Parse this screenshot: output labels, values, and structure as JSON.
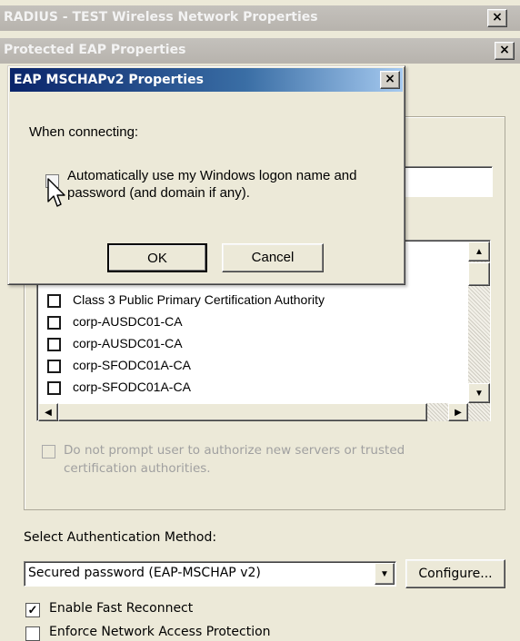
{
  "windows": {
    "outer_title": "RADIUS - TEST Wireless Network Properties",
    "peap_title": "Protected EAP Properties",
    "mschap_title": "EAP MSCHAPv2 Properties",
    "close_glyph": "×"
  },
  "mschap": {
    "when_connecting": "When connecting:",
    "auto_logon_line1": "Automatically use my Windows logon name and",
    "auto_logon_line2": "password (and domain if any).",
    "ok_label": "OK",
    "cancel_label": "Cancel"
  },
  "trusted_ca": {
    "items": [
      "Class 3 Public Primary Certification Authority",
      "corp-AUSDC01-CA",
      "corp-AUSDC01-CA",
      "corp-SFODC01A-CA",
      "corp-SFODC01A-CA"
    ],
    "do_not_prompt_line1": "Do not prompt user to authorize new servers or trusted",
    "do_not_prompt_line2": "certification authorities."
  },
  "auth": {
    "select_label": "Select Authentication Method:",
    "method_value": "Secured password (EAP-MSCHAP v2)",
    "configure_label": "Configure...",
    "fast_reconnect_label": "Enable Fast Reconnect",
    "fast_reconnect_checked": true,
    "nap_label": "Enforce Network Access Protection",
    "nap_checked": false
  },
  "icons": {
    "check": "✓",
    "arrow_up": "▲",
    "arrow_down": "▼",
    "arrow_left": "◀",
    "arrow_right": "▶"
  }
}
